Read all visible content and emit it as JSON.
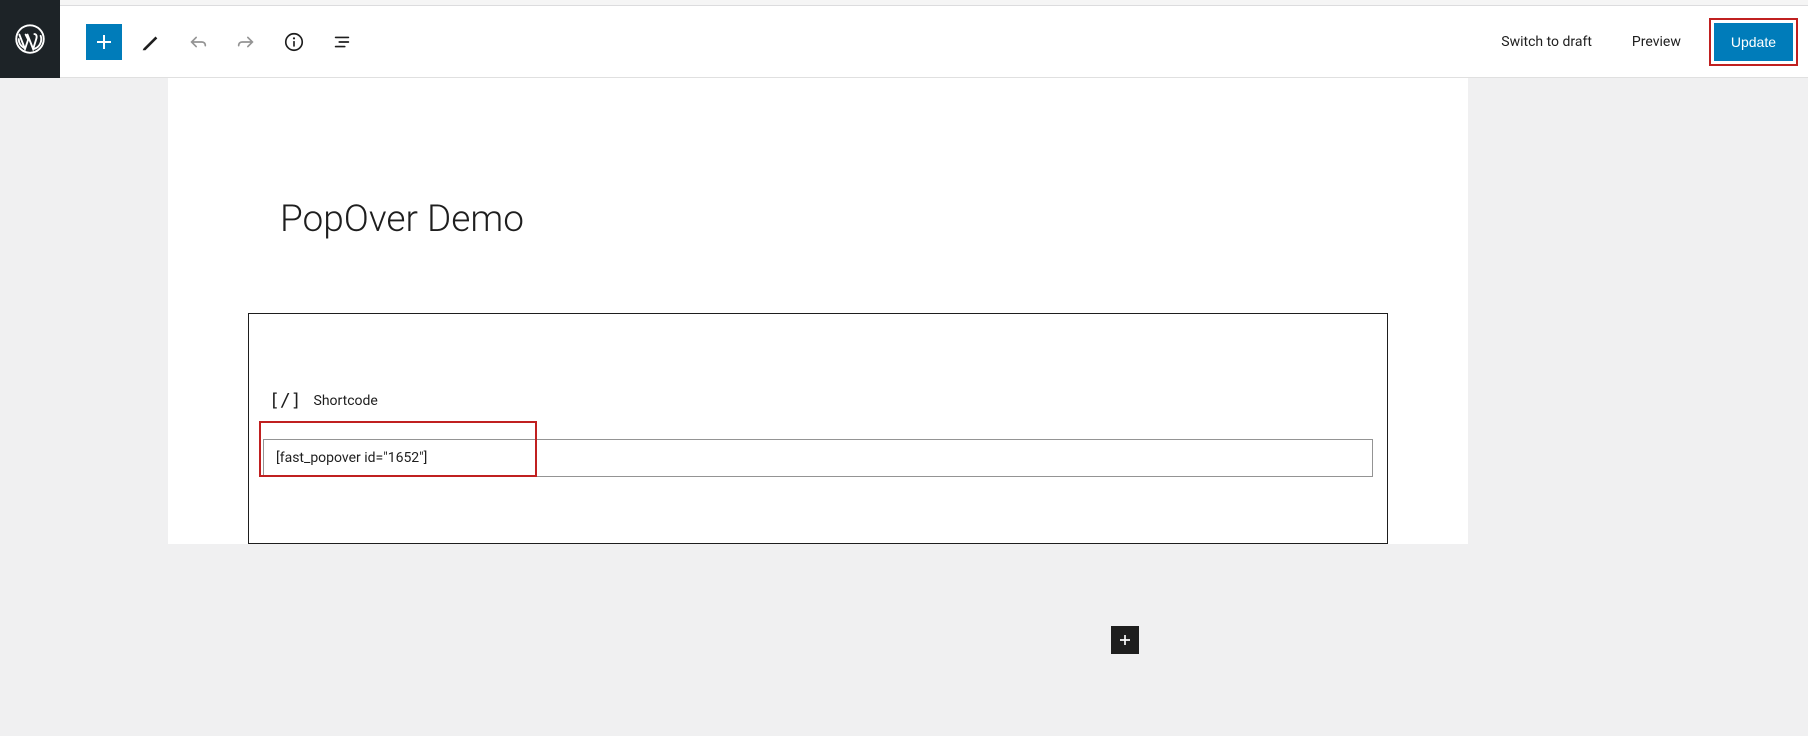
{
  "toolbar": {
    "switch_to_draft": "Switch to draft",
    "preview": "Preview",
    "update": "Update"
  },
  "post": {
    "title": "PopOver Demo"
  },
  "block": {
    "label": "Shortcode",
    "value": "[fast_popover id=\"1652\"]"
  }
}
